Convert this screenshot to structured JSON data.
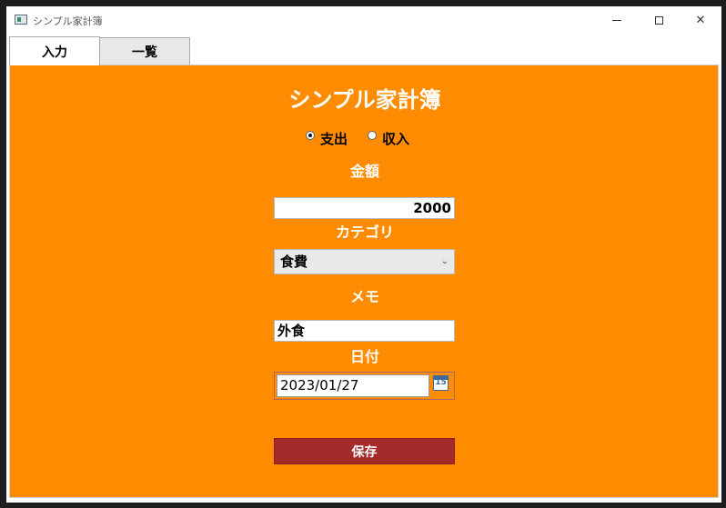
{
  "window": {
    "title": "シンプル家計簿"
  },
  "tabs": [
    {
      "label": "入力"
    },
    {
      "label": "一覧"
    }
  ],
  "form": {
    "heading": "シンプル家計簿",
    "radios": [
      {
        "label": "支出",
        "checked": true
      },
      {
        "label": "収入",
        "checked": false
      }
    ],
    "amount": {
      "label": "金額",
      "value": "2000"
    },
    "category": {
      "label": "カテゴリ",
      "value": "食費"
    },
    "memo": {
      "label": "メモ",
      "value": "外食"
    },
    "date": {
      "label": "日付",
      "value": "2023/01/27",
      "calendar_day": "15"
    },
    "save_label": "保存"
  },
  "colors": {
    "panel_bg": "#ff8c00",
    "save_bg": "#a52a2a"
  },
  "icons": {
    "app": "app-window-icon",
    "calendar": "calendar-icon"
  }
}
